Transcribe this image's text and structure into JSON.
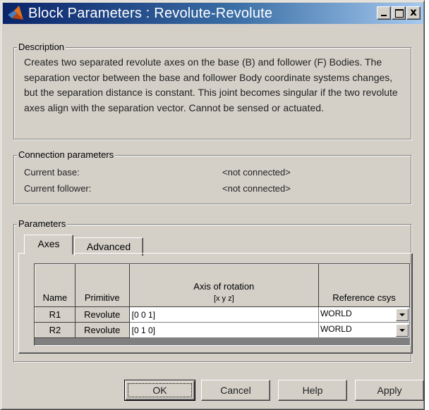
{
  "window": {
    "title": "Block Parameters : Revolute-Revolute",
    "icon": "matlab-logo-icon",
    "controls": {
      "minimize": "_",
      "maximize": "□",
      "close": "x"
    }
  },
  "description": {
    "legend": "Description",
    "text": "Creates two separated revolute axes on the base (B) and follower (F) Bodies. The separation vector between the base and follower Body coordinate systems changes, but the separation distance is constant. This joint becomes singular if the two revolute axes align with the separation vector. Cannot be sensed or actuated."
  },
  "connection": {
    "legend": "Connection parameters",
    "rows": [
      {
        "label": "Current base:",
        "value": "<not connected>"
      },
      {
        "label": "Current follower:",
        "value": "<not connected>"
      }
    ]
  },
  "parameters": {
    "legend": "Parameters",
    "tabs": [
      {
        "label": "Axes",
        "active": true
      },
      {
        "label": "Advanced",
        "active": false
      }
    ],
    "table": {
      "headers": {
        "name": "Name",
        "primitive": "Primitive",
        "axis_line1": "Axis of rotation",
        "axis_line2": "[x y z]",
        "reference": "Reference csys"
      },
      "rows": [
        {
          "name": "R1",
          "primitive": "Revolute",
          "axis": "[0 0 1]",
          "reference": "WORLD"
        },
        {
          "name": "R2",
          "primitive": "Revolute",
          "axis": "[0 1 0]",
          "reference": "WORLD"
        }
      ]
    }
  },
  "buttons": {
    "ok": "OK",
    "cancel": "Cancel",
    "help": "Help",
    "apply": "Apply"
  },
  "colors": {
    "dialog_face": "#d4d0c8",
    "title_start": "#0a246a",
    "title_end": "#a6caf0"
  }
}
